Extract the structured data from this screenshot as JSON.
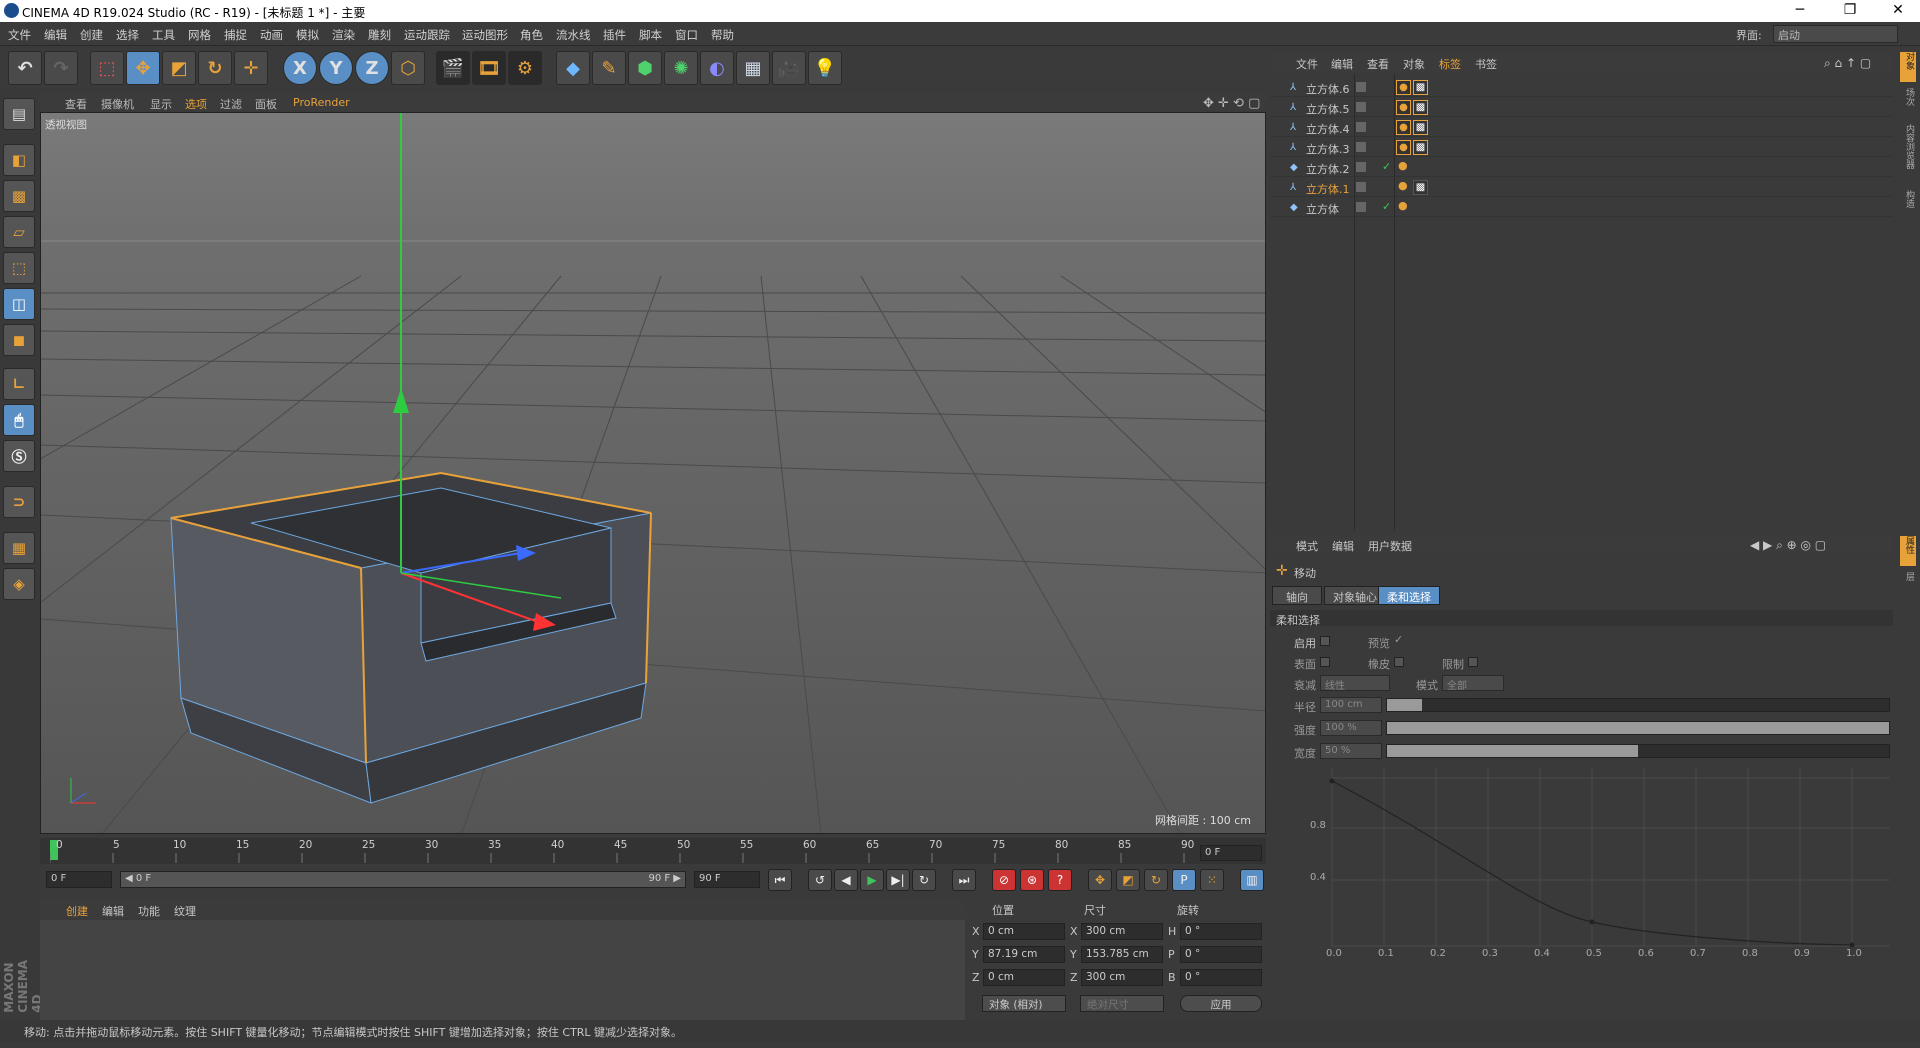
{
  "titlebar": {
    "title": "CINEMA 4D R19.024 Studio (RC - R19) - [未标题 1 *] - 主要",
    "min": "─",
    "max": "❐",
    "close": "✕"
  },
  "menu": [
    "文件",
    "编辑",
    "创建",
    "选择",
    "工具",
    "网格",
    "捕捉",
    "动画",
    "模拟",
    "渲染",
    "雕刻",
    "运动跟踪",
    "运动图形",
    "角色",
    "流水线",
    "插件",
    "脚本",
    "窗口",
    "帮助"
  ],
  "interface": {
    "label": "界面:",
    "value": "启动"
  },
  "toolbar": {
    "x": "X",
    "y": "Y",
    "z": "Z"
  },
  "viewport": {
    "menu": [
      "查看",
      "摄像机",
      "显示",
      "选项",
      "过滤",
      "面板",
      "ProRender"
    ],
    "label": "透视视图",
    "grid_spacing": "网格间距 : 100 cm"
  },
  "timeline": {
    "ticks": [
      "0",
      "5",
      "10",
      "15",
      "20",
      "25",
      "30",
      "35",
      "40",
      "45",
      "50",
      "55",
      "60",
      "65",
      "70",
      "75",
      "80",
      "85",
      "90"
    ],
    "current_frame": "0 F"
  },
  "playbar": {
    "start": "0 F",
    "range_start": "◀ 0 F",
    "range_end": "90 F ▶",
    "end": "90 F"
  },
  "materials": {
    "menu": [
      "创建",
      "编辑",
      "功能",
      "纹理"
    ]
  },
  "coords": {
    "headers": [
      "位置",
      "尺寸",
      "旋转"
    ],
    "rows": [
      {
        "axis": "X",
        "pos": "0 cm",
        "size_axis": "X",
        "size": "300 cm",
        "rot_axis": "H",
        "rot": "0 °"
      },
      {
        "axis": "Y",
        "pos": "87.19 cm",
        "size_axis": "Y",
        "size": "153.785 cm",
        "rot_axis": "P",
        "rot": "0 °"
      },
      {
        "axis": "Z",
        "pos": "0 cm",
        "size_axis": "Z",
        "size": "300 cm",
        "rot_axis": "B",
        "rot": "0 °"
      }
    ],
    "mode": "对象 (相对)",
    "size_mode": "绝对尺寸",
    "apply": "应用"
  },
  "status": "移动: 点击并拖动鼠标移动元素。按住 SHIFT 键量化移动；节点编辑模式时按住 SHIFT 键增加选择对象；按住 CTRL 键减少选择对象。",
  "object_manager": {
    "menu": [
      "文件",
      "编辑",
      "查看",
      "对象",
      "标签",
      "书签"
    ],
    "objects": [
      {
        "name": "立方体.6",
        "selected": false
      },
      {
        "name": "立方体.5",
        "selected": false
      },
      {
        "name": "立方体.4",
        "selected": false
      },
      {
        "name": "立方体.3",
        "selected": false
      },
      {
        "name": "立方体.2",
        "selected": false
      },
      {
        "name": "立方体.1",
        "selected": true
      },
      {
        "name": "立方体",
        "selected": false
      }
    ]
  },
  "attribute_manager": {
    "menu": [
      "模式",
      "编辑",
      "用户数据"
    ],
    "tool_name": "移动",
    "tabs": [
      "轴向",
      "对象轴心",
      "柔和选择"
    ],
    "section": "柔和选择",
    "enable": "启用",
    "preview": "预览",
    "surface": "表面",
    "rubber": "橡皮",
    "limit": "限制",
    "falloff_label": "衰减",
    "falloff": "线性",
    "mode_label": "模式",
    "mode": "全部",
    "radius_label": "半径",
    "radius": "100 cm",
    "radius_fill": 0.07,
    "strength_label": "强度",
    "strength": "100 %",
    "strength_fill": 1.0,
    "width_label": "宽度",
    "width": "50 %",
    "width_fill": 0.5,
    "graph_y": [
      "0.8",
      "0.4"
    ],
    "graph_x": [
      "0.0",
      "0.1",
      "0.2",
      "0.3",
      "0.4",
      "0.5",
      "0.6",
      "0.7",
      "0.8",
      "0.9",
      "1.0"
    ]
  },
  "right_strip": [
    "对象",
    "场次",
    "内容浏览器",
    "构造",
    "属性",
    "层"
  ]
}
